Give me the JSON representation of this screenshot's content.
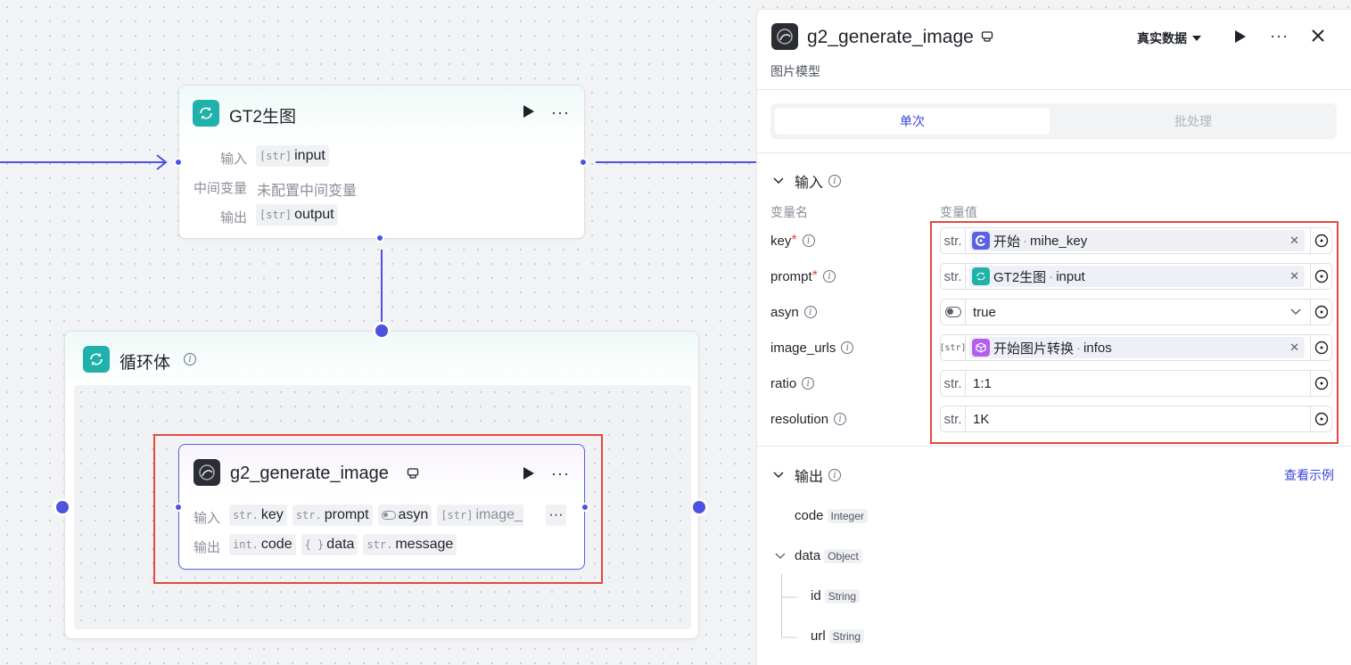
{
  "canvas": {
    "gt2_node": {
      "title": "GT2生图",
      "rows": [
        {
          "label": "输入",
          "type": "[str]",
          "value": "input"
        },
        {
          "label": "中间变量",
          "value": "未配置中间变量"
        },
        {
          "label": "输出",
          "type": "[str]",
          "value": "output"
        }
      ]
    },
    "loop_node": {
      "title": "循环体"
    },
    "g2_node": {
      "title": "g2_generate_image",
      "input_label": "输入",
      "output_label": "输出",
      "inputs": [
        {
          "type": "str.",
          "name": "key"
        },
        {
          "type": "str.",
          "name": "prompt"
        },
        {
          "type": "toggle",
          "name": "asyn"
        },
        {
          "type": "[str]",
          "name": "image_url"
        }
      ],
      "outputs": [
        {
          "type": "int.",
          "name": "code"
        },
        {
          "type": "{ }",
          "name": "data"
        },
        {
          "type": "str.",
          "name": "message"
        }
      ],
      "more": "···"
    }
  },
  "panel": {
    "title": "g2_generate_image",
    "subtitle": "图片模型",
    "data_mode": "真实数据",
    "tabs": [
      "单次",
      "批处理"
    ],
    "input_section": "输入",
    "col_name": "变量名",
    "col_value": "变量值",
    "vars": [
      {
        "name": "key",
        "required": true,
        "type": "str.",
        "ref_node": "开始",
        "ref_var": "mihe_key",
        "ref_icon": "start"
      },
      {
        "name": "prompt",
        "required": true,
        "type": "str.",
        "ref_node": "GT2生图",
        "ref_var": "input",
        "ref_icon": "loop"
      },
      {
        "name": "asyn",
        "required": false,
        "type": "toggle",
        "value": "true"
      },
      {
        "name": "image_urls",
        "required": false,
        "type": "[str]",
        "ref_node": "开始图片转换",
        "ref_var": "infos",
        "ref_icon": "cube"
      },
      {
        "name": "ratio",
        "required": false,
        "type": "str.",
        "value": "1:1"
      },
      {
        "name": "resolution",
        "required": false,
        "type": "str.",
        "value": "1K"
      }
    ],
    "output_section": "输出",
    "view_example": "查看示例",
    "outputs": [
      {
        "name": "code",
        "type": "Integer",
        "level": 0
      },
      {
        "name": "data",
        "type": "Object",
        "level": 0
      },
      {
        "name": "id",
        "type": "String",
        "level": 1
      },
      {
        "name": "url",
        "type": "String",
        "level": 1
      }
    ]
  }
}
